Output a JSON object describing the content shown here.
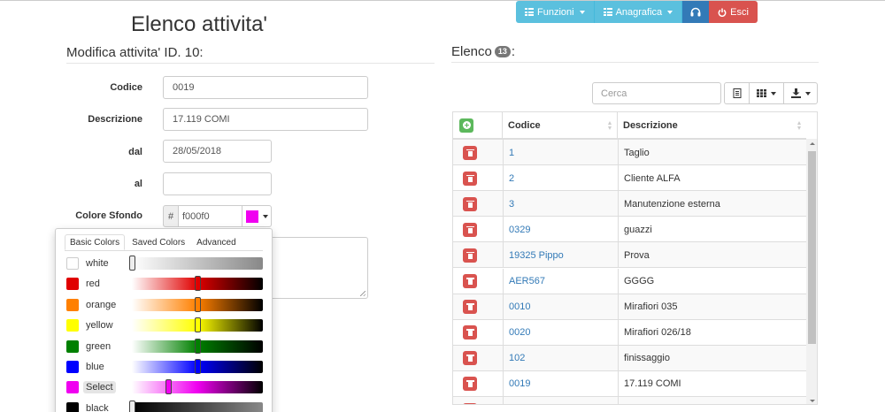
{
  "nav": {
    "funzioni": "Funzioni",
    "anagrafica": "Anagrafica",
    "esci": "Esci"
  },
  "page": {
    "title": "Elenco attivita'",
    "form_section": "Modifica attivita' ID. 10:",
    "list_section": "Elenco",
    "list_count": "13",
    "list_suffix": ":"
  },
  "form": {
    "codice_label": "Codice",
    "codice_value": "0019",
    "descrizione_label": "Descrizione",
    "descrizione_value": "17.119 COMI",
    "dal_label": "dal",
    "dal_value": "28/05/2018",
    "al_label": "al",
    "al_value": "",
    "colore_label": "Colore Sfondo",
    "colore_hash": "#",
    "colore_value": "f000f0",
    "colore_hex": "#f000f0"
  },
  "picker": {
    "tabs": [
      "Basic Colors",
      "Saved Colors",
      "Advanced"
    ],
    "active_tab": "Basic Colors",
    "colors": [
      {
        "name": "white",
        "hex": "#ffffff",
        "level": 0.0
      },
      {
        "name": "red",
        "hex": "#e00000",
        "level": 0.5
      },
      {
        "name": "orange",
        "hex": "#ff8000",
        "level": 0.5
      },
      {
        "name": "yellow",
        "hex": "#ffff00",
        "level": 0.5
      },
      {
        "name": "green",
        "hex": "#008000",
        "level": 0.5
      },
      {
        "name": "blue",
        "hex": "#0000ff",
        "level": 0.5
      },
      {
        "name": "Select",
        "hex": "#f000f0",
        "level": 0.28,
        "selected": true
      },
      {
        "name": "black",
        "hex": "#000000",
        "level": 0.0
      }
    ]
  },
  "list": {
    "search_placeholder": "Cerca",
    "columns": [
      "Codice",
      "Descrizione"
    ],
    "rows": [
      {
        "codice": "1",
        "descrizione": "Taglio"
      },
      {
        "codice": "2",
        "descrizione": "Cliente ALFA"
      },
      {
        "codice": "3",
        "descrizione": "Manutenzione esterna"
      },
      {
        "codice": "0329",
        "descrizione": "guazzi"
      },
      {
        "codice": "19325 Pippo",
        "descrizione": "Prova"
      },
      {
        "codice": "AER567",
        "descrizione": "GGGG"
      },
      {
        "codice": "0010",
        "descrizione": "Mirafiori 035"
      },
      {
        "codice": "0020",
        "descrizione": "Mirafiori 026/18"
      },
      {
        "codice": "102",
        "descrizione": "finissaggio"
      },
      {
        "codice": "0019",
        "descrizione": "17.119 COMI"
      },
      {
        "codice": "",
        "descrizione": ""
      }
    ]
  },
  "colors": {
    "info": "#5bc0de",
    "primary": "#337ab7",
    "danger": "#d9534f",
    "success": "#5cb85c"
  }
}
